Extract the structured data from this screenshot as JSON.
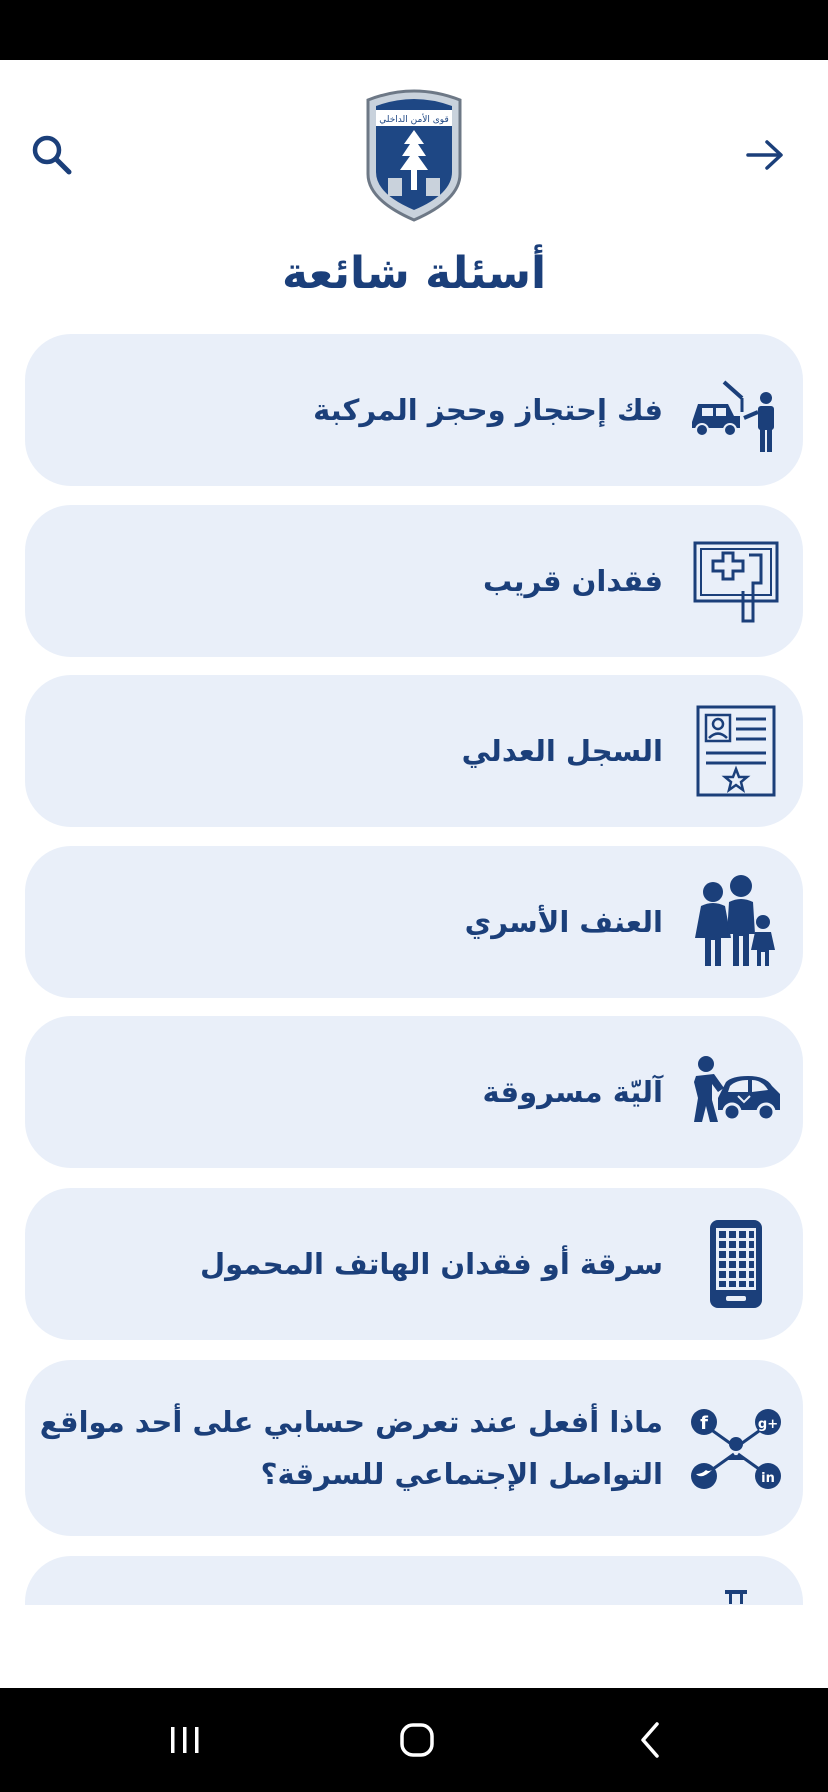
{
  "header": {
    "title": "أسئلة شائعة",
    "search_icon": "search-icon",
    "back_icon": "arrow-right-icon",
    "logo": "isf-emblem",
    "logo_text": "قوى الأمن الداخلي"
  },
  "faq": {
    "items": [
      {
        "label": "فك إحتجاز وحجز المركبة",
        "icon": "tow-truck-icon"
      },
      {
        "label": "فقدان قريب",
        "icon": "missing-person-icon"
      },
      {
        "label": "السجل العدلي",
        "icon": "certificate-icon"
      },
      {
        "label": "العنف الأسري",
        "icon": "family-icon"
      },
      {
        "label": "آليّة مسروقة",
        "icon": "stolen-car-icon"
      },
      {
        "label": "سرقة أو فقدان الهاتف المحمول",
        "icon": "mobile-phone-icon"
      },
      {
        "label": "ماذا أفعل عند تعرض حسابي على أحد مواقع التواصل الإجتماعي للسرقة؟",
        "icon": "social-network-icon"
      },
      {
        "label": "",
        "icon": "partial-icon"
      }
    ]
  },
  "colors": {
    "primary": "#1b3f7a",
    "card_bg": "#e9eff9"
  },
  "navbar": {
    "recent_icon": "recent-apps-icon",
    "home_icon": "home-icon",
    "back_icon": "back-chevron-icon"
  }
}
